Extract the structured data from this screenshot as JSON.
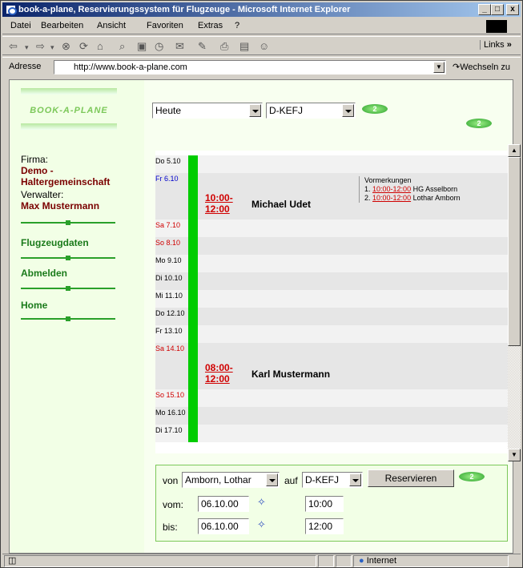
{
  "window": {
    "title": "book-a-plane, Reservierungssystem für Flugzeuge - Microsoft Internet Explorer",
    "btn_min": "_",
    "btn_max": "□",
    "btn_close": "x"
  },
  "menu": {
    "items": [
      "Datei",
      "Bearbeiten",
      "Ansicht",
      "Favoriten",
      "Extras",
      "?"
    ]
  },
  "toolbar": {
    "links_label": "Links",
    "links_arrow": "»"
  },
  "address": {
    "label": "Adresse",
    "url": "http://www.book-a-plane.com",
    "go_label": "Wechseln zu"
  },
  "sidebar": {
    "logo_text": "BOOK-A-PLANE",
    "firma_label": "Firma:",
    "firma_value": "Demo - Haltergemeinschaft",
    "verwalter_label": "Verwalter:",
    "verwalter_value": "Max Mustermann",
    "links": [
      "Flugzeugdaten",
      "Abmelden",
      "Home"
    ]
  },
  "filter": {
    "period": "Heute",
    "plane": "D-KEFJ",
    "go": "2"
  },
  "calendar": {
    "rows": [
      {
        "day": "Do 5.10",
        "color": "#000000",
        "bg": "#f2f2f2"
      },
      {
        "day": "Fr 6.10",
        "color": "#0000cc",
        "bg": "#e6e6e6"
      },
      {
        "day": "Sa 7.10",
        "color": "#d00000",
        "bg": "#f2f2f2"
      },
      {
        "day": "So 8.10",
        "color": "#d00000",
        "bg": "#e6e6e6"
      },
      {
        "day": "Mo 9.10",
        "color": "#000000",
        "bg": "#f2f2f2"
      },
      {
        "day": "Di 10.10",
        "color": "#000000",
        "bg": "#e6e6e6"
      },
      {
        "day": "Mi 11.10",
        "color": "#000000",
        "bg": "#f2f2f2"
      },
      {
        "day": "Do 12.10",
        "color": "#000000",
        "bg": "#e6e6e6"
      },
      {
        "day": "Fr 13.10",
        "color": "#000000",
        "bg": "#f2f2f2"
      },
      {
        "day": "Sa 14.10",
        "color": "#d00000",
        "bg": "#e6e6e6"
      },
      {
        "day": "So 15.10",
        "color": "#d00000",
        "bg": "#f2f2f2"
      },
      {
        "day": "Mo 16.10",
        "color": "#000000",
        "bg": "#e6e6e6"
      },
      {
        "day": "Di 17.10",
        "color": "#000000",
        "bg": "#f2f2f2"
      }
    ],
    "reservations": [
      {
        "time": "10:00-12:00",
        "name": "Michael Udet"
      },
      {
        "time": "08:00-12:00",
        "name": "Karl Mustermann"
      }
    ],
    "vormerkungen": {
      "title": "Vormerkungen",
      "items": [
        {
          "num": "1.",
          "time": "10:00-12:00",
          "name": "HG Asselborn"
        },
        {
          "num": "2.",
          "time": "10:00-12:00",
          "name": "Lothar Amborn"
        }
      ]
    },
    "free_color": "#00cc00",
    "booked_color": "#ee0000"
  },
  "form": {
    "von_label": "von",
    "person": "Amborn, Lothar",
    "auf_label": "auf",
    "plane": "D-KEFJ",
    "reserve_label": "Reservieren",
    "go": "2",
    "vom_label": "vom:",
    "vom_date": "06.10.00",
    "vom_time": "10:00",
    "bis_label": "bis:",
    "bis_date": "06.10.00",
    "bis_time": "12:00"
  },
  "status": {
    "zone": "Internet"
  }
}
